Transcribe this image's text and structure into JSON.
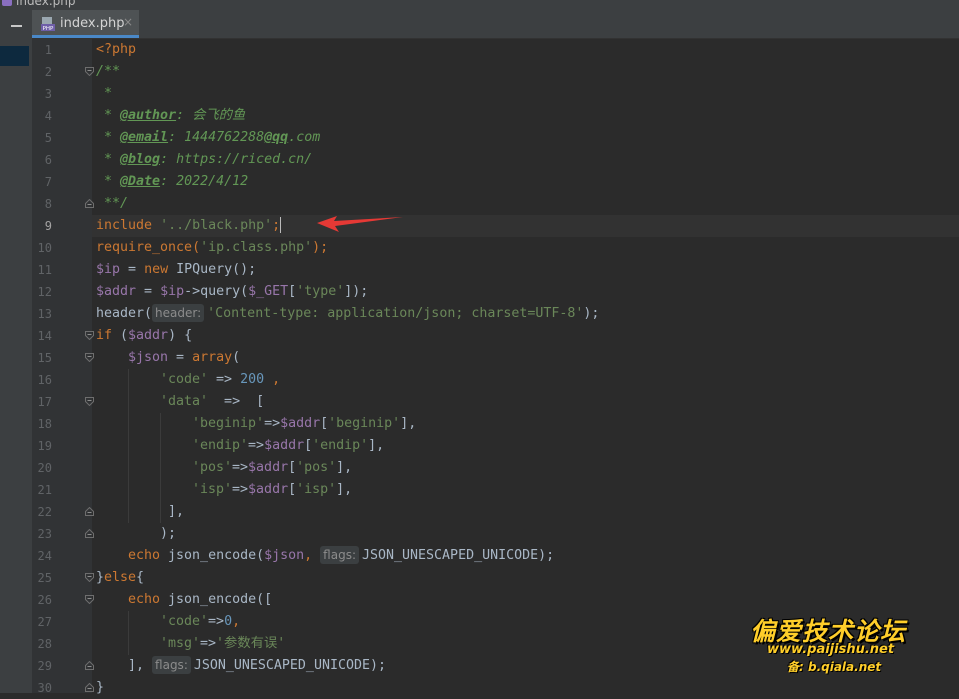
{
  "window": {
    "title": "index.php"
  },
  "tab": {
    "label": "index.php",
    "close_glyph": "×",
    "icon": "php-file-icon"
  },
  "editor": {
    "current_line": 9,
    "line_numbers": [
      "1",
      "2",
      "3",
      "4",
      "5",
      "6",
      "7",
      "8",
      "9",
      "10",
      "11",
      "12",
      "13",
      "14",
      "15",
      "16",
      "17",
      "18",
      "19",
      "20",
      "21",
      "22",
      "23",
      "24",
      "25",
      "26",
      "27",
      "28",
      "29",
      "30"
    ],
    "code": {
      "l1": "<?php",
      "l2": "/**",
      "l3": " *",
      "l4_prefix": " * ",
      "l4_tag": "@author",
      "l4_text": ": 会飞的鱼",
      "l5_prefix": " * ",
      "l5_tag": "@email",
      "l5_text": ": 1444762288",
      "l5_at": "@qq",
      "l5_tail": ".com",
      "l6_prefix": " * ",
      "l6_tag": "@blog",
      "l6_text": ": https://riced.cn/",
      "l7_prefix": " * ",
      "l7_tag": "@Date",
      "l7_text": ": 2022/4/12",
      "l8": " **/",
      "l9_kw": "include",
      "l9_str": "'../black.php'",
      "l9_end": ";",
      "l10_fn": "require_once(",
      "l10_str": "'ip.class.php'",
      "l10_end": ");",
      "l11_var": "$ip",
      "l11_eq": " = ",
      "l11_kw": "new",
      "l11_rest": " IPQuery();",
      "l12_var": "$addr",
      "l12_eq": " = ",
      "l12_var2": "$ip",
      "l12_mid": "->query(",
      "l12_var3": "$_GET",
      "l12_br": "[",
      "l12_str": "'type'",
      "l12_end": "]);",
      "l13_fn": "header(",
      "l13_hint": "header:",
      "l13_str": "'Content-type: application/json; charset=UTF-8'",
      "l13_end": ");",
      "l14_kw": "if",
      "l14_open": " (",
      "l14_var": "$addr",
      "l14_end": ") {",
      "l15_var": "$json",
      "l15_eq": " = ",
      "l15_kw": "array",
      "l15_end": "(",
      "l16_str": "'code'",
      "l16_arrow": " => ",
      "l16_num": "200",
      "l16_end": " ,",
      "l17_str": "'data'",
      "l17_arrow": "  =>  ",
      "l17_end": "[",
      "l18_str": "'beginip'",
      "l18_arrow": "=>",
      "l18_var": "$addr",
      "l18_str2": "'beginip'",
      "l18_end": "],",
      "l19_str": "'endip'",
      "l19_arrow": "=>",
      "l19_var": "$addr",
      "l19_str2": "'endip'",
      "l19_end": "],",
      "l20_str": "'pos'",
      "l20_arrow": "=>",
      "l20_var": "$addr",
      "l20_str2": "'pos'",
      "l20_end": "],",
      "l21_str": "'isp'",
      "l21_arrow": "=>",
      "l21_var": "$addr",
      "l21_str2": "'isp'",
      "l21_end": "],",
      "l22": "],",
      "l23": ");",
      "l24_kw": "echo",
      "l24_fn": " json_encode(",
      "l24_var": "$json",
      "l24_comma": ",",
      "l24_hint": "flags:",
      "l24_end": "JSON_UNESCAPED_UNICODE);",
      "l25_brace": "}",
      "l25_kw": "else",
      "l25_end": "{",
      "l26_kw": "echo",
      "l26_fn": " json_encode([",
      "l27_str": "'code'",
      "l27_arrow": "=>",
      "l27_num": "0",
      "l27_end": ",",
      "l28_str": "'msg'",
      "l28_arrow": "=>",
      "l28_str2": "'参数有误'",
      "l29_open": "], ",
      "l29_hint": "flags:",
      "l29_end": "JSON_UNESCAPED_UNICODE);",
      "l30": "}"
    }
  },
  "watermark": {
    "title": "偏爱技术论坛",
    "url": "www.paijishu.net",
    "backup": "备: b.qiala.net"
  },
  "colors": {
    "background": "#2b2b2b",
    "keyword": "#cc7832",
    "string": "#6a8759",
    "variable": "#9876aa",
    "number": "#6897bb",
    "comment": "#629755",
    "arrow": "#e53935",
    "watermark": "#ffce2a"
  }
}
